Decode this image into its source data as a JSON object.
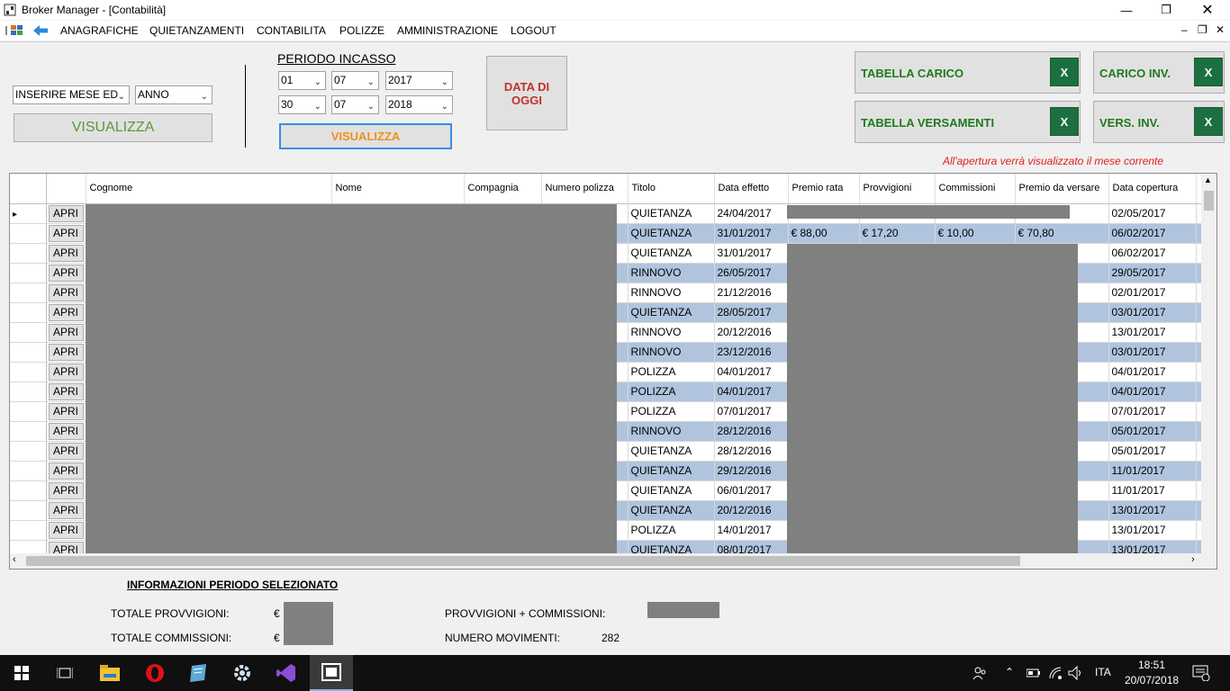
{
  "window": {
    "title": "Broker Manager - [Contabilità]"
  },
  "menu": {
    "items": [
      "ANAGRAFICHE",
      "QUIETANZAMENTI",
      "CONTABILITA",
      "POLIZZE",
      "AMMINISTRAZIONE",
      "LOGOUT"
    ]
  },
  "filters": {
    "month_value": "INSERIRE MESE ED",
    "year_value": "ANNO",
    "visualizza_label": "VISUALIZZA",
    "periodo_label": "PERIODO INCASSO",
    "from_day": "01",
    "from_month": "07",
    "from_year": "2017",
    "to_day": "30",
    "to_month": "07",
    "to_year": "2018",
    "visualizza2_label": "VISUALIZZA",
    "data_oggi_label": "DATA DI OGGI"
  },
  "export": {
    "tabella_carico": "TABELLA CARICO",
    "carico_inv": "CARICO INV.",
    "tabella_versamenti": "TABELLA VERSAMENTI",
    "vers_inv": "VERS. INV.",
    "excel_icon_text": "X",
    "note": "All'apertura verrà visualizzato il mese corrente"
  },
  "grid": {
    "columns": [
      "Cognome",
      "Nome",
      "Compagnia",
      "Numero polizza",
      "Titolo",
      "Data effetto",
      "Premio rata",
      "Provvigioni",
      "Commissioni",
      "Premio da versare",
      "Data copertura"
    ],
    "apri_label": "APRI",
    "rows": [
      {
        "titolo": "QUIETANZA",
        "effetto": "24/04/2017",
        "premio": "",
        "provv": "",
        "comm": "",
        "versare": "",
        "copertura": "02/05/2017"
      },
      {
        "titolo": "QUIETANZA",
        "effetto": "31/01/2017",
        "premio": "€ 88,00",
        "provv": "€ 17,20",
        "comm": "€ 10,00",
        "versare": "€ 70,80",
        "copertura": "06/02/2017"
      },
      {
        "titolo": "QUIETANZA",
        "effetto": "31/01/2017",
        "premio": "",
        "provv": "",
        "comm": "",
        "versare": "",
        "copertura": "06/02/2017"
      },
      {
        "titolo": "RINNOVO",
        "effetto": "26/05/2017",
        "premio": "",
        "provv": "",
        "comm": "",
        "versare": "",
        "copertura": "29/05/2017"
      },
      {
        "titolo": "RINNOVO",
        "effetto": "21/12/2016",
        "premio": "",
        "provv": "",
        "comm": "",
        "versare": "",
        "copertura": "02/01/2017"
      },
      {
        "titolo": "QUIETANZA",
        "effetto": "28/05/2017",
        "premio": "",
        "provv": "",
        "comm": "",
        "versare": "",
        "copertura": "03/01/2017"
      },
      {
        "titolo": "RINNOVO",
        "effetto": "20/12/2016",
        "premio": "",
        "provv": "",
        "comm": "",
        "versare": "",
        "copertura": "13/01/2017"
      },
      {
        "titolo": "RINNOVO",
        "effetto": "23/12/2016",
        "premio": "",
        "provv": "",
        "comm": "",
        "versare": "",
        "copertura": "03/01/2017"
      },
      {
        "titolo": "POLIZZA",
        "effetto": "04/01/2017",
        "premio": "",
        "provv": "",
        "comm": "",
        "versare": "",
        "copertura": "04/01/2017"
      },
      {
        "titolo": "POLIZZA",
        "effetto": "04/01/2017",
        "premio": "",
        "provv": "",
        "comm": "",
        "versare": "",
        "copertura": "04/01/2017"
      },
      {
        "titolo": "POLIZZA",
        "effetto": "07/01/2017",
        "premio": "",
        "provv": "",
        "comm": "",
        "versare": "",
        "copertura": "07/01/2017"
      },
      {
        "titolo": "RINNOVO",
        "effetto": "28/12/2016",
        "premio": "",
        "provv": "",
        "comm": "",
        "versare": "",
        "copertura": "05/01/2017"
      },
      {
        "titolo": "QUIETANZA",
        "effetto": "28/12/2016",
        "premio": "",
        "provv": "",
        "comm": "",
        "versare": "",
        "copertura": "05/01/2017"
      },
      {
        "titolo": "QUIETANZA",
        "effetto": "29/12/2016",
        "premio": "",
        "provv": "",
        "comm": "",
        "versare": "",
        "copertura": "11/01/2017"
      },
      {
        "titolo": "QUIETANZA",
        "effetto": "06/01/2017",
        "premio": "",
        "provv": "",
        "comm": "",
        "versare": "",
        "copertura": "11/01/2017"
      },
      {
        "titolo": "QUIETANZA",
        "effetto": "20/12/2016",
        "premio": "",
        "provv": "",
        "comm": "",
        "versare": "",
        "copertura": "13/01/2017"
      },
      {
        "titolo": "POLIZZA",
        "effetto": "14/01/2017",
        "premio": "",
        "provv": "",
        "comm": "",
        "versare": "",
        "copertura": "13/01/2017"
      },
      {
        "titolo": "QUIETANZA",
        "effetto": "08/01/2017",
        "premio": "",
        "provv": "",
        "comm": "",
        "versare": "",
        "copertura": "13/01/2017"
      }
    ]
  },
  "summary": {
    "heading": "INFORMAZIONI PERIODO SELEZIONATO",
    "totale_provvigioni_label": "TOTALE PROVVIGIONI:",
    "totale_commissioni_label": "TOTALE COMMISSIONI:",
    "currency": "€",
    "provv_comm_label": "PROVVIGIONI + COMMISSIONI:",
    "numero_movimenti_label": "NUMERO MOVIMENTI:",
    "numero_movimenti_value": "282"
  },
  "taskbar": {
    "lang": "ITA",
    "time": "18:51",
    "date": "20/07/2018"
  }
}
